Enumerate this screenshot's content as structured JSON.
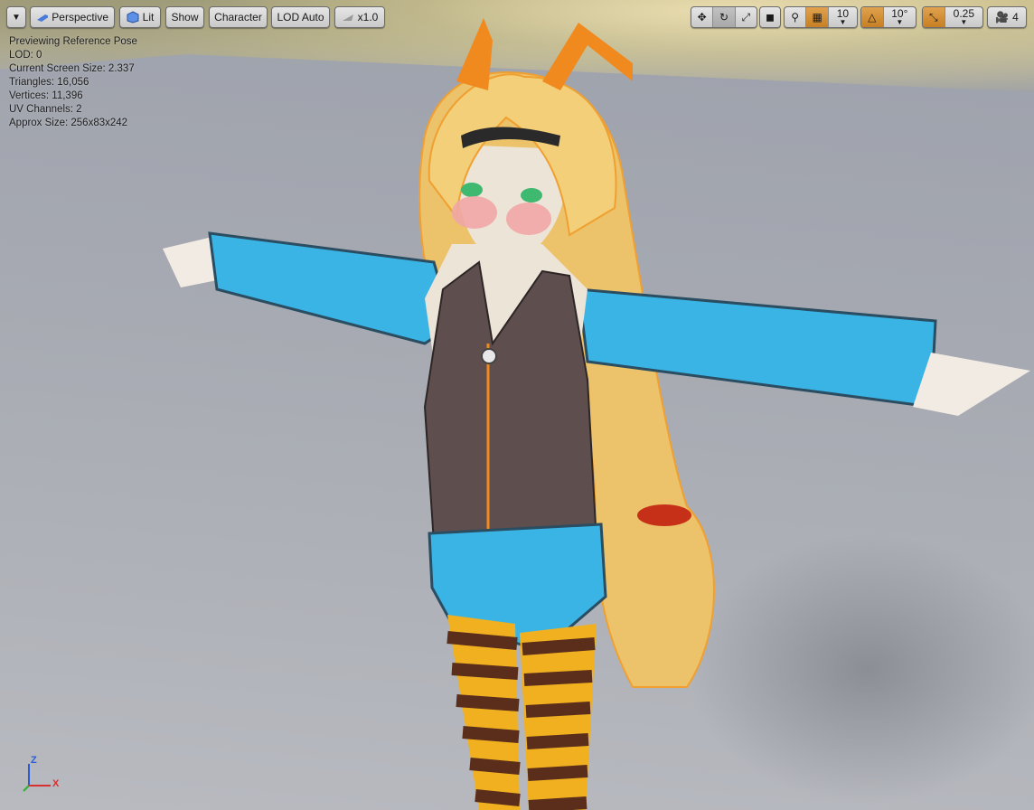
{
  "toolbar": {
    "menu_icon": "chevron-down-icon",
    "perspective_label": "Perspective",
    "lit_label": "Lit",
    "show_label": "Show",
    "character_label": "Character",
    "lod_label": "LOD Auto",
    "speed_label": "x1.0",
    "grid_snap_value": "10",
    "rotation_snap_value": "10°",
    "scale_snap_value": "0.25",
    "camera_speed_value": "4",
    "accent_color": "#c77f22"
  },
  "stats": {
    "lines": [
      "Previewing Reference Pose",
      "LOD: 0",
      "Current Screen Size: 2.337",
      "Triangles: 16,056",
      "Vertices: 11,396",
      "UV Channels: 2",
      "Approx Size: 256x83x242"
    ]
  },
  "axis": {
    "z": "Z",
    "x": "X"
  }
}
